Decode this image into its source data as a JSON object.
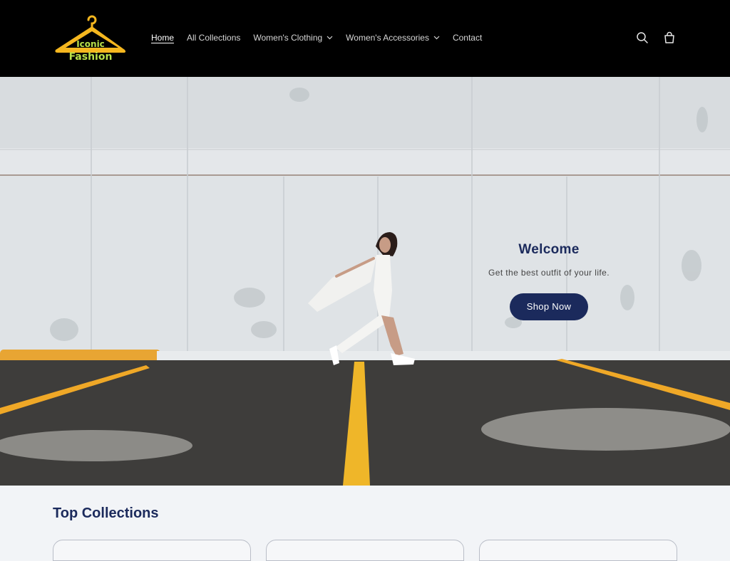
{
  "brand": {
    "logo_line1": "Iconic",
    "logo_line2": "Fashion"
  },
  "nav": {
    "items": [
      {
        "label": "Home",
        "active": true
      },
      {
        "label": "All Collections"
      },
      {
        "label": "Women's Clothing",
        "dropdown": true
      },
      {
        "label": "Women's Accessories",
        "dropdown": true
      },
      {
        "label": "Contact"
      }
    ]
  },
  "icons": {
    "search": "search-icon",
    "cart": "cart-icon"
  },
  "hero": {
    "title": "Welcome",
    "subtitle": "Get the best outfit of your life.",
    "button": "Shop Now"
  },
  "collections": {
    "title": "Top Collections"
  },
  "colors": {
    "header_bg": "#000000",
    "accent": "#1b2a5c",
    "logo_yellow": "#f5b71f",
    "logo_green": "#b8e04a"
  }
}
